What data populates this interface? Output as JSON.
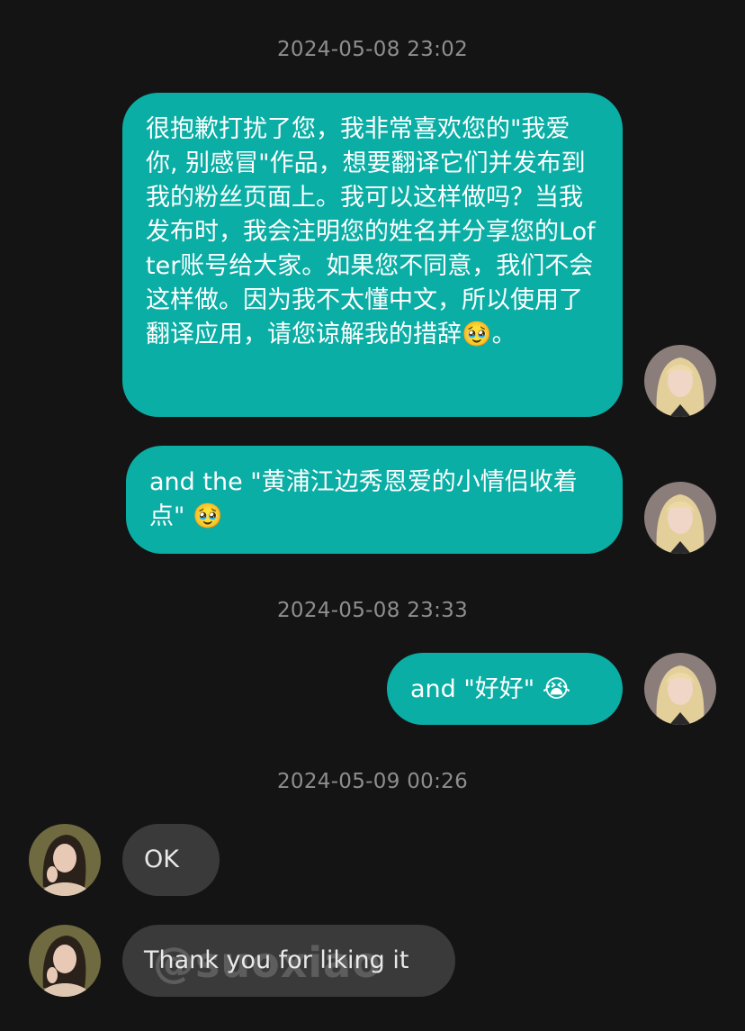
{
  "messages": {
    "ts1": "2024-05-08 23:02",
    "msg1": "很抱歉打扰了您，我非常喜欢您的\"我爱你, 别感冒\"作品，想要翻译它们并发布到我的粉丝页面上。我可以这样做吗？当我发布时，我会注明您的姓名并分享您的Lofter账号给大家。如果您不同意，我们不会这样做。因为我不太懂中文，所以使用了翻译应用，请您谅解我的措辞🥹。",
    "msg2": "and the \"黄浦江边秀恩爱的小情侣收着点\" 🥹",
    "ts2": "2024-05-08 23:33",
    "msg3": "and \"好好\" 😭",
    "ts3": "2024-05-09 00:26",
    "msg4": "OK",
    "msg5": "Thank you for liking it"
  },
  "watermark": "@suoxiao",
  "colors": {
    "background": "#141414",
    "outgoing_bubble": "#0aaea5",
    "incoming_bubble": "#3a3a3a",
    "timestamp_text": "#8e8e8e"
  },
  "icons": {
    "sender_avatar": "blonde-woman-avatar",
    "receiver_avatar": "dark-haired-woman-avatar"
  }
}
